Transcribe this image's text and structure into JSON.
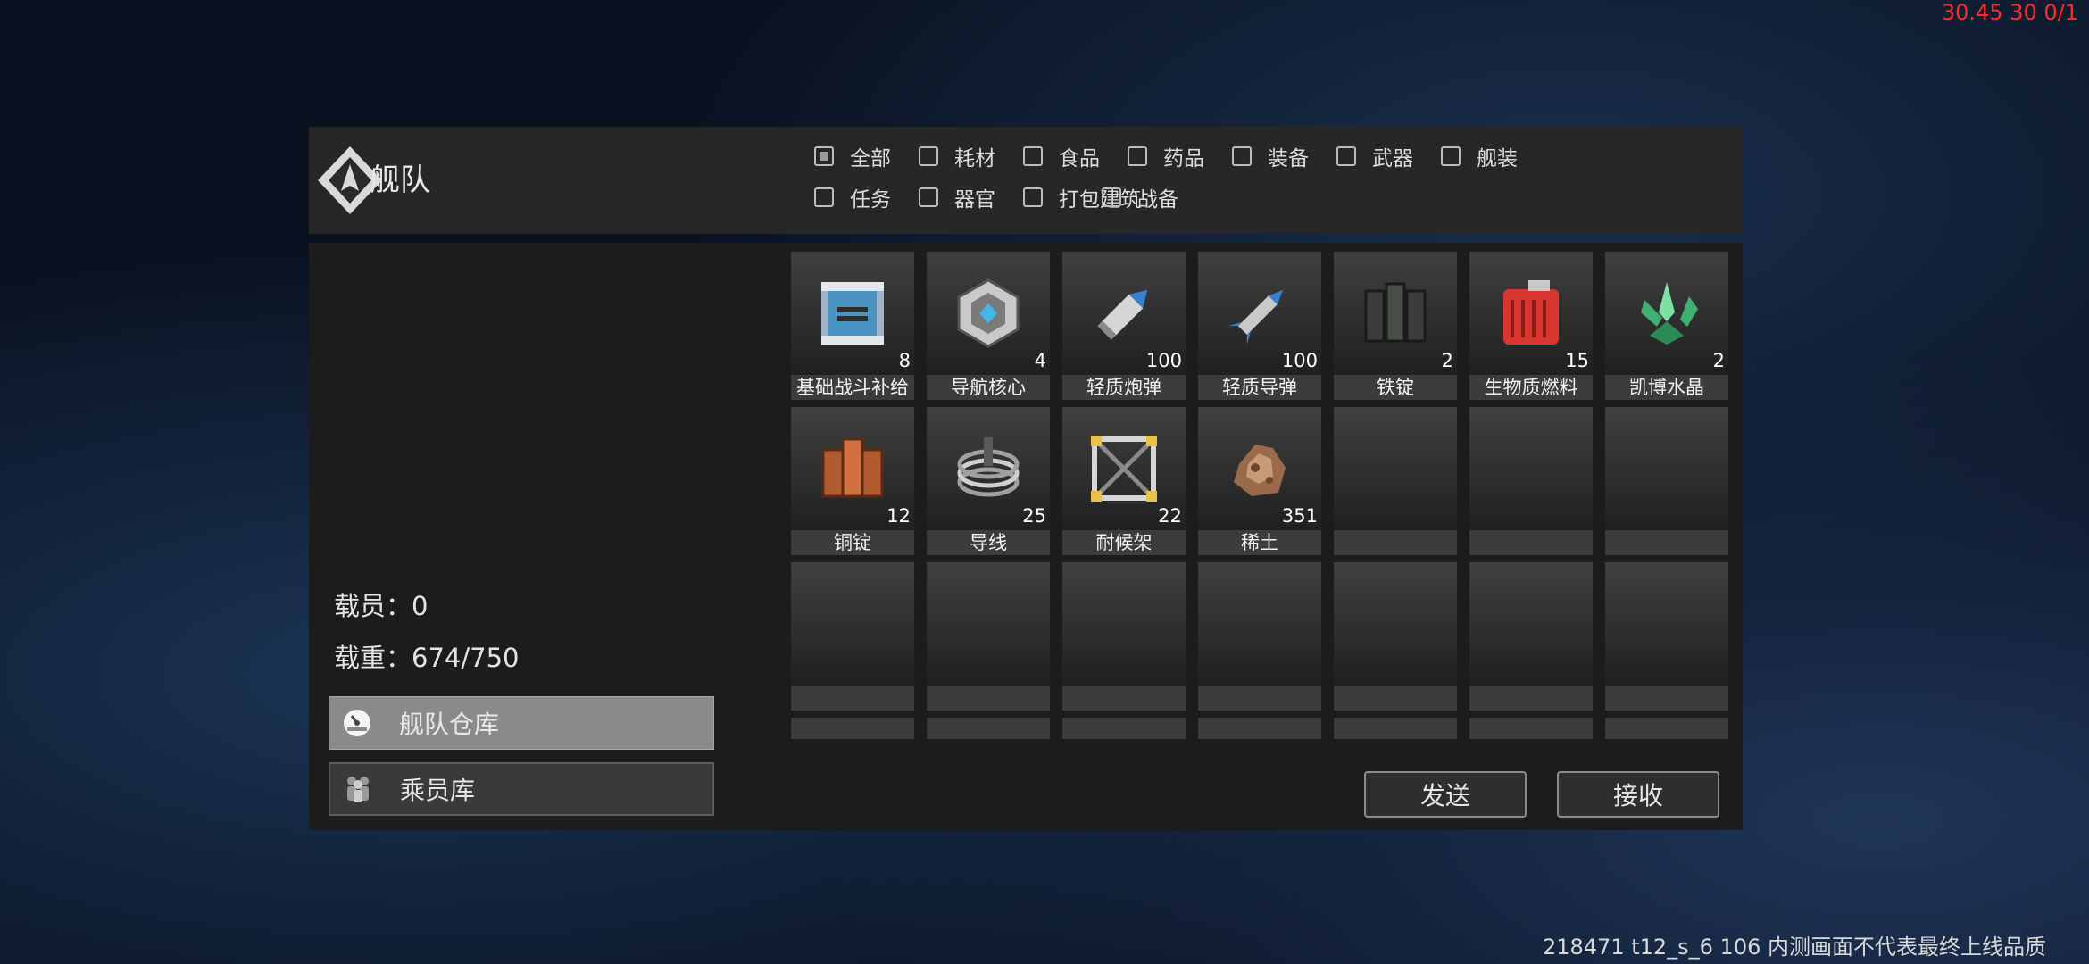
{
  "debug": {
    "fps": "30.45 30 0/1",
    "footer": "218471 t12_s_6 106  内测画面不代表最终上线品质"
  },
  "header": {
    "title": "舰队"
  },
  "filters": [
    {
      "label": "全部",
      "checked": true
    },
    {
      "label": "耗材",
      "checked": false
    },
    {
      "label": "食品",
      "checked": false
    },
    {
      "label": "药品",
      "checked": false
    },
    {
      "label": "装备",
      "checked": false
    },
    {
      "label": "武器",
      "checked": false
    },
    {
      "label": "舰装",
      "checked": false
    },
    {
      "label": "任务",
      "checked": false
    },
    {
      "label": "器官",
      "checked": false
    },
    {
      "label": "打包建筑",
      "checked": false
    },
    {
      "label": "战备",
      "checked": false
    }
  ],
  "stats": {
    "crew": "载员：0",
    "load": "载重：674/750"
  },
  "tabs": {
    "warehouse": "舰队仓库",
    "crew": "乘员库"
  },
  "items": [
    {
      "name": "基础战斗补给",
      "count": "8",
      "icon": "supply-crate-icon"
    },
    {
      "name": "导航核心",
      "count": "4",
      "icon": "nav-core-icon"
    },
    {
      "name": "轻质炮弹",
      "count": "100",
      "icon": "shell-icon"
    },
    {
      "name": "轻质导弹",
      "count": "100",
      "icon": "missile-icon"
    },
    {
      "name": "铁锭",
      "count": "2",
      "icon": "iron-ingot-icon"
    },
    {
      "name": "生物质燃料",
      "count": "15",
      "icon": "fuel-can-icon"
    },
    {
      "name": "凯博水晶",
      "count": "2",
      "icon": "crystal-icon"
    },
    {
      "name": "铜锭",
      "count": "12",
      "icon": "copper-ingot-icon"
    },
    {
      "name": "导线",
      "count": "25",
      "icon": "wire-coil-icon"
    },
    {
      "name": "耐候架",
      "count": "22",
      "icon": "frame-icon"
    },
    {
      "name": "稀土",
      "count": "351",
      "icon": "rare-earth-icon"
    }
  ],
  "buttons": {
    "send": "发送",
    "receive": "接收"
  }
}
